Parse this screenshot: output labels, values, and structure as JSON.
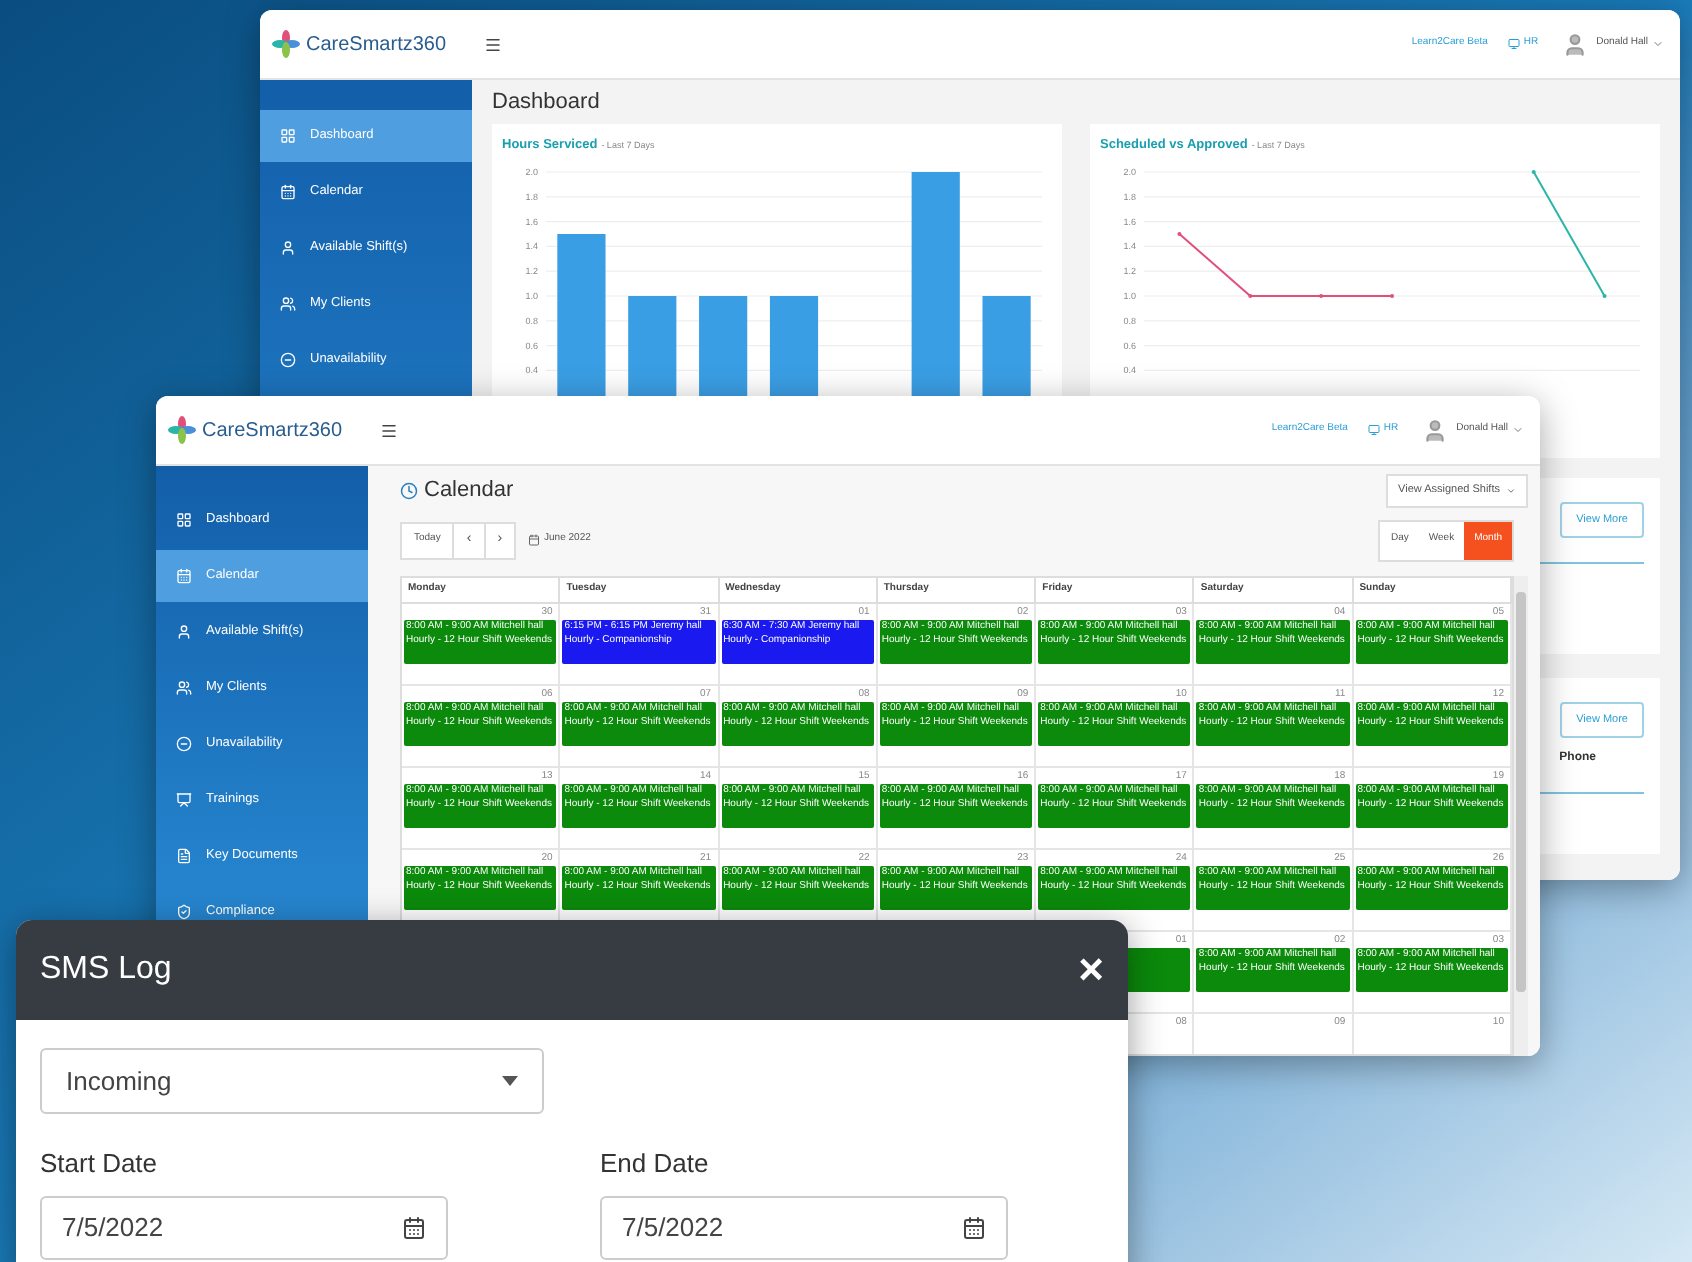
{
  "dashboard_window": {
    "logo": "CareSmartz360",
    "beta_link": "Learn2Care Beta",
    "hr_link": "HR",
    "user": "Donald Hall",
    "sidebar": [
      {
        "label": "Dashboard",
        "selected": true
      },
      {
        "label": "Calendar",
        "selected": false
      },
      {
        "label": "Available Shift(s)",
        "selected": false
      },
      {
        "label": "My Clients",
        "selected": false
      },
      {
        "label": "Unavailability",
        "selected": false
      }
    ],
    "title": "Dashboard",
    "charts": [
      {
        "title": "Hours Serviced",
        "subtitle": "- Last 7 Days",
        "chart_data": {
          "type": "bar",
          "grid": true,
          "ylim": [
            0.4,
            2
          ],
          "yticks": [
            {
              "value": 0.4,
              "label": "0.4"
            },
            {
              "value": 0.6,
              "label": "0.6"
            },
            {
              "value": 0.8,
              "label": "0.8"
            },
            {
              "value": 1,
              "label": "1.0"
            },
            {
              "value": 1.2,
              "label": "1.2"
            },
            {
              "value": 1.4,
              "label": "1.4"
            },
            {
              "value": 1.6,
              "label": "1.6"
            },
            {
              "value": 1.8,
              "label": "1.8"
            },
            {
              "value": 2,
              "label": "2.0"
            }
          ],
          "series": [
            {
              "color": "#3a9ee4",
              "values": [
                1.5,
                1,
                1,
                1,
                null,
                2,
                1
              ]
            }
          ]
        }
      },
      {
        "title": "Scheduled vs Approved",
        "subtitle": "- Last 7 Days",
        "chart_data": {
          "type": "line",
          "grid": true,
          "ylim": [
            0.4,
            2
          ],
          "yticks": [
            {
              "value": 0.4,
              "label": "0.4"
            },
            {
              "value": 0.6,
              "label": "0.6"
            },
            {
              "value": 0.8,
              "label": "0.8"
            },
            {
              "value": 1,
              "label": "1.0"
            },
            {
              "value": 1.2,
              "label": "1.2"
            },
            {
              "value": 1.4,
              "label": "1.4"
            },
            {
              "value": 1.6,
              "label": "1.6"
            },
            {
              "value": 1.8,
              "label": "1.8"
            },
            {
              "value": 2,
              "label": "2.0"
            }
          ],
          "series": [
            {
              "color": "#e0507a",
              "values": [
                1.5,
                1,
                1,
                1,
                null,
                null,
                null
              ]
            },
            {
              "color": "#2bb5a8",
              "values": [
                null,
                null,
                null,
                null,
                null,
                2,
                1
              ]
            }
          ]
        }
      }
    ],
    "cards": [
      {
        "button": "View More"
      },
      {
        "button": "View More",
        "text": "Phone"
      }
    ]
  },
  "calendar_window": {
    "logo": "CareSmartz360",
    "beta_link": "Learn2Care Beta",
    "hr_link": "HR",
    "user": "Donald Hall",
    "sidebar": [
      {
        "label": "Dashboard",
        "selected": false
      },
      {
        "label": "Calendar",
        "selected": true
      },
      {
        "label": "Available Shift(s)",
        "selected": false
      },
      {
        "label": "My Clients",
        "selected": false
      },
      {
        "label": "Unavailability",
        "selected": false
      },
      {
        "label": "Trainings",
        "selected": false
      },
      {
        "label": "Key Documents",
        "selected": false
      },
      {
        "label": "Compliance",
        "selected": false
      }
    ],
    "title": "Calendar",
    "view_select": "View Assigned Shifts",
    "toolbar": {
      "today": "Today",
      "prev": "‹",
      "next": "›",
      "month_label": "June 2022",
      "views": [
        {
          "label": "Day",
          "selected": false
        },
        {
          "label": "Week",
          "selected": false
        },
        {
          "label": "Month",
          "selected": true
        }
      ]
    },
    "weekdays": [
      "Monday",
      "Tuesday",
      "Wednesday",
      "Thursday",
      "Friday",
      "Saturday",
      "Sunday"
    ],
    "weeks": [
      {
        "days": [
          {
            "date": "30",
            "event": {
              "text": "8:00 AM - 9:00 AM Mitchell hall Hourly - 12 Hour Shift Weekends",
              "color": "#0b8a0b"
            }
          },
          {
            "date": "31",
            "event": {
              "text": "6:15 PM - 6:15 PM Jeremy hall Hourly - Companionship",
              "color": "#1a1af0"
            }
          },
          {
            "date": "01",
            "event": {
              "text": "6:30 AM - 7:30 AM Jeremy hall Hourly - Companionship",
              "color": "#1a1af0"
            }
          },
          {
            "date": "02",
            "event": {
              "text": "8:00 AM - 9:00 AM Mitchell hall Hourly - 12 Hour Shift Weekends",
              "color": "#0b8a0b"
            }
          },
          {
            "date": "03",
            "event": {
              "text": "8:00 AM - 9:00 AM Mitchell hall Hourly - 12 Hour Shift Weekends",
              "color": "#0b8a0b"
            }
          },
          {
            "date": "04",
            "event": {
              "text": "8:00 AM - 9:00 AM Mitchell hall Hourly - 12 Hour Shift Weekends",
              "color": "#0b8a0b"
            }
          },
          {
            "date": "05",
            "event": {
              "text": "8:00 AM - 9:00 AM Mitchell hall Hourly - 12 Hour Shift Weekends",
              "color": "#0b8a0b"
            }
          }
        ]
      },
      {
        "days": [
          {
            "date": "06",
            "event": {
              "text": "8:00 AM - 9:00 AM Mitchell hall Hourly - 12 Hour Shift Weekends",
              "color": "#0b8a0b"
            }
          },
          {
            "date": "07",
            "event": {
              "text": "8:00 AM - 9:00 AM Mitchell hall Hourly - 12 Hour Shift Weekends",
              "color": "#0b8a0b"
            }
          },
          {
            "date": "08",
            "event": {
              "text": "8:00 AM - 9:00 AM Mitchell hall Hourly - 12 Hour Shift Weekends",
              "color": "#0b8a0b"
            }
          },
          {
            "date": "09",
            "event": {
              "text": "8:00 AM - 9:00 AM Mitchell hall Hourly - 12 Hour Shift Weekends",
              "color": "#0b8a0b"
            }
          },
          {
            "date": "10",
            "event": {
              "text": "8:00 AM - 9:00 AM Mitchell hall Hourly - 12 Hour Shift Weekends",
              "color": "#0b8a0b"
            }
          },
          {
            "date": "11",
            "event": {
              "text": "8:00 AM - 9:00 AM Mitchell hall Hourly - 12 Hour Shift Weekends",
              "color": "#0b8a0b"
            }
          },
          {
            "date": "12",
            "event": {
              "text": "8:00 AM - 9:00 AM Mitchell hall Hourly - 12 Hour Shift Weekends",
              "color": "#0b8a0b"
            }
          }
        ]
      },
      {
        "days": [
          {
            "date": "13",
            "event": {
              "text": "8:00 AM - 9:00 AM Mitchell hall Hourly - 12 Hour Shift Weekends",
              "color": "#0b8a0b"
            }
          },
          {
            "date": "14",
            "event": {
              "text": "8:00 AM - 9:00 AM Mitchell hall Hourly - 12 Hour Shift Weekends",
              "color": "#0b8a0b"
            }
          },
          {
            "date": "15",
            "event": {
              "text": "8:00 AM - 9:00 AM Mitchell hall Hourly - 12 Hour Shift Weekends",
              "color": "#0b8a0b"
            }
          },
          {
            "date": "16",
            "event": {
              "text": "8:00 AM - 9:00 AM Mitchell hall Hourly - 12 Hour Shift Weekends",
              "color": "#0b8a0b"
            }
          },
          {
            "date": "17",
            "event": {
              "text": "8:00 AM - 9:00 AM Mitchell hall Hourly - 12 Hour Shift Weekends",
              "color": "#0b8a0b"
            }
          },
          {
            "date": "18",
            "event": {
              "text": "8:00 AM - 9:00 AM Mitchell hall Hourly - 12 Hour Shift Weekends",
              "color": "#0b8a0b"
            }
          },
          {
            "date": "19",
            "event": {
              "text": "8:00 AM - 9:00 AM Mitchell hall Hourly - 12 Hour Shift Weekends",
              "color": "#0b8a0b"
            }
          }
        ]
      },
      {
        "days": [
          {
            "date": "20",
            "event": {
              "text": "8:00 AM - 9:00 AM Mitchell hall Hourly - 12 Hour Shift Weekends",
              "color": "#0b8a0b"
            }
          },
          {
            "date": "21",
            "event": {
              "text": "8:00 AM - 9:00 AM Mitchell hall Hourly - 12 Hour Shift Weekends",
              "color": "#0b8a0b"
            }
          },
          {
            "date": "22",
            "event": {
              "text": "8:00 AM - 9:00 AM Mitchell hall Hourly - 12 Hour Shift Weekends",
              "color": "#0b8a0b"
            }
          },
          {
            "date": "23",
            "event": {
              "text": "8:00 AM - 9:00 AM Mitchell hall Hourly - 12 Hour Shift Weekends",
              "color": "#0b8a0b"
            }
          },
          {
            "date": "24",
            "event": {
              "text": "8:00 AM - 9:00 AM Mitchell hall Hourly - 12 Hour Shift Weekends",
              "color": "#0b8a0b"
            }
          },
          {
            "date": "25",
            "event": {
              "text": "8:00 AM - 9:00 AM Mitchell hall Hourly - 12 Hour Shift Weekends",
              "color": "#0b8a0b"
            }
          },
          {
            "date": "26",
            "event": {
              "text": "8:00 AM - 9:00 AM Mitchell hall Hourly - 12 Hour Shift Weekends",
              "color": "#0b8a0b"
            }
          }
        ]
      },
      {
        "days": [
          {
            "date": "01",
            "event": {
              "color": "#0b8a0b"
            }
          },
          {
            "date": "02",
            "event": {
              "text": "8:00 AM - 9:00 AM Mitchell hall Hourly - 12 Hour Shift Weekends",
              "color": "#0b8a0b"
            }
          },
          {
            "date": "03",
            "event": {
              "text": "8:00 AM - 9:00 AM Mitchell hall Hourly - 12 Hour Shift Weekends",
              "color": "#0b8a0b"
            }
          }
        ]
      },
      {
        "days": [
          {
            "date": "08"
          },
          {
            "date": "09"
          },
          {
            "date": "10"
          }
        ]
      }
    ]
  },
  "sms_dialog": {
    "title": "SMS Log",
    "close": "×",
    "direction": "Incoming",
    "fields": [
      {
        "label": "Start Date",
        "value": "7/5/2022"
      },
      {
        "label": "End Date",
        "value": "7/5/2022"
      }
    ]
  }
}
